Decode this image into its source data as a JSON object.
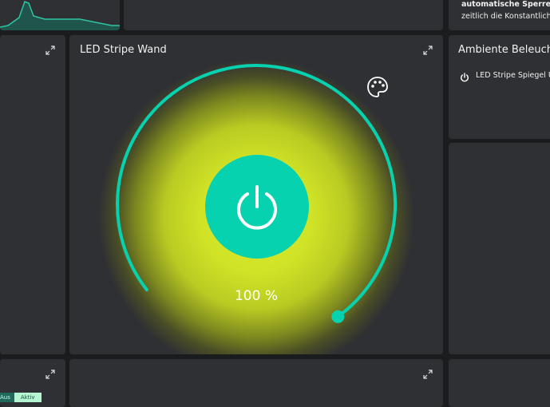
{
  "tiles": {
    "graph_tile": {
      "chart_color": "#2ec5a4"
    },
    "info_tile": {
      "line1": "automatische Sperre de",
      "line2": "zeitlich die Konstantlicht"
    },
    "main_tile": {
      "title": "LED Stripe Wand",
      "brightness_label": "100 %",
      "brightness": 100,
      "accent_color": "#06d2b0",
      "light_color": "#d7ea2a"
    },
    "ambient_tile": {
      "title": "Ambiente Beleuchtu",
      "item_label": "LED Stripe Spiegel Un"
    },
    "bottom_left_tile": {
      "toggle_left": "Aus",
      "toggle_right": "Aktiv"
    }
  }
}
